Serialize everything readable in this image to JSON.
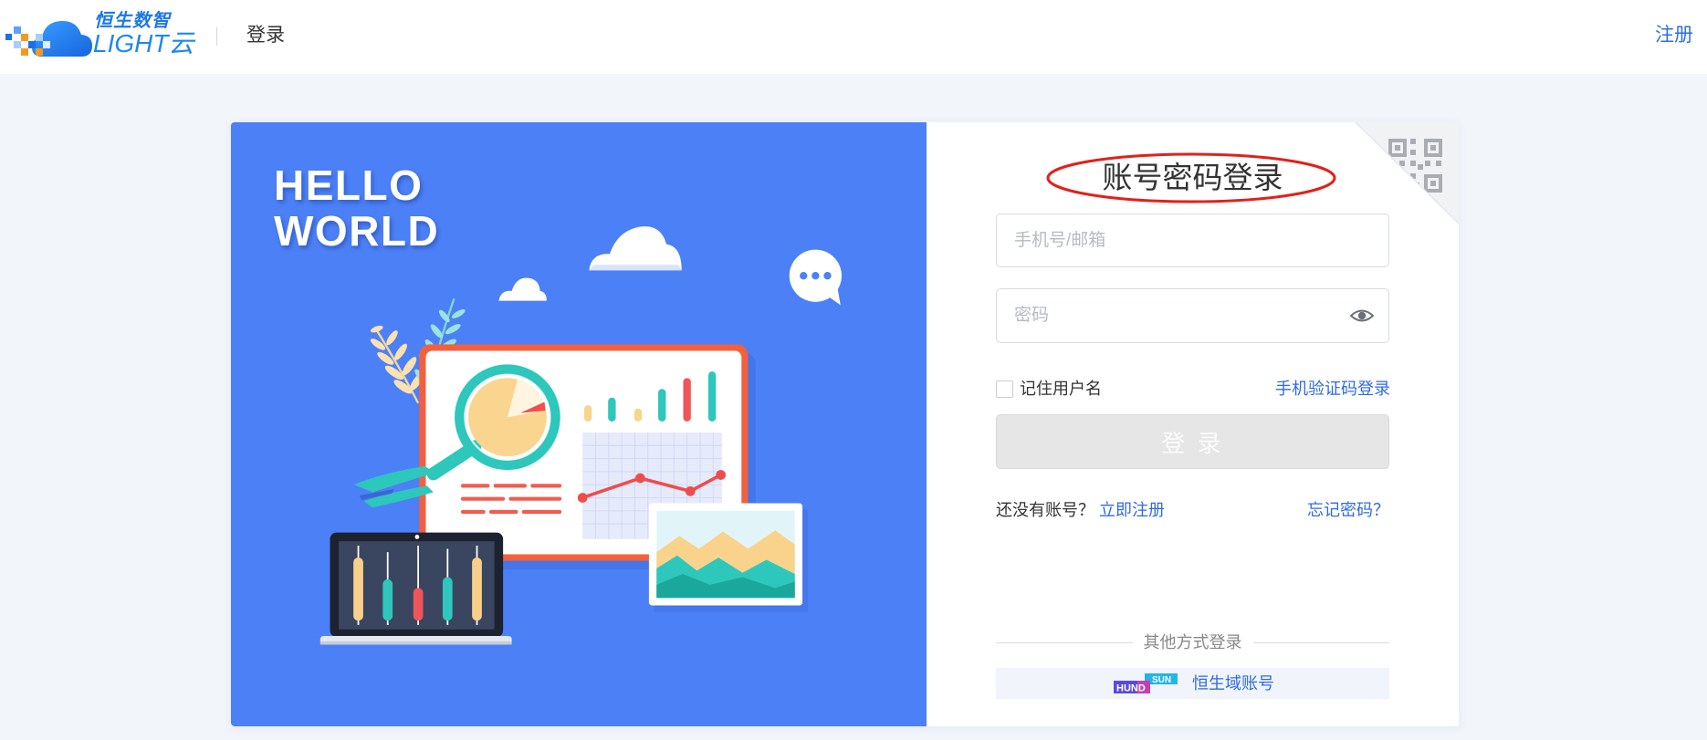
{
  "header": {
    "logo": {
      "line1": "恒生数智",
      "line2": "LIGHT云",
      "icon": "cloud-logo-icon"
    },
    "page_label": "登录",
    "register_link": "注册"
  },
  "banner": {
    "headline_line1": "HELLO",
    "headline_line2": "WORLD"
  },
  "login_form": {
    "title": "账号密码登录",
    "qr_toggle_icon": "qr-code-icon",
    "account": {
      "placeholder": "手机号/邮箱",
      "value": ""
    },
    "password": {
      "placeholder": "密码",
      "value": "",
      "toggle_icon": "eye-icon"
    },
    "remember": {
      "label": "记住用户名",
      "checked": false
    },
    "sms_login_link": "手机验证码登录",
    "submit_label": "登 录",
    "submit_enabled": false,
    "no_account_text": "还没有账号？",
    "register_now_link": "立即注册",
    "forgot_password_link": "忘记密码？",
    "other_methods_label": "其他方式登录",
    "hundsun": {
      "logo_part1": "HUND",
      "logo_part2": "SUN",
      "link": "恒生域账号"
    }
  },
  "colors": {
    "brand_blue": "#4c80f7",
    "link_blue": "#2f6be0",
    "page_bg": "#f2f5fa",
    "button_disabled_bg": "#e6e6e6",
    "annotation_red": "#e3201b",
    "accent_teal": "#2ec7bb",
    "accent_yellow": "#f8d48d",
    "accent_red": "#f0555a"
  }
}
